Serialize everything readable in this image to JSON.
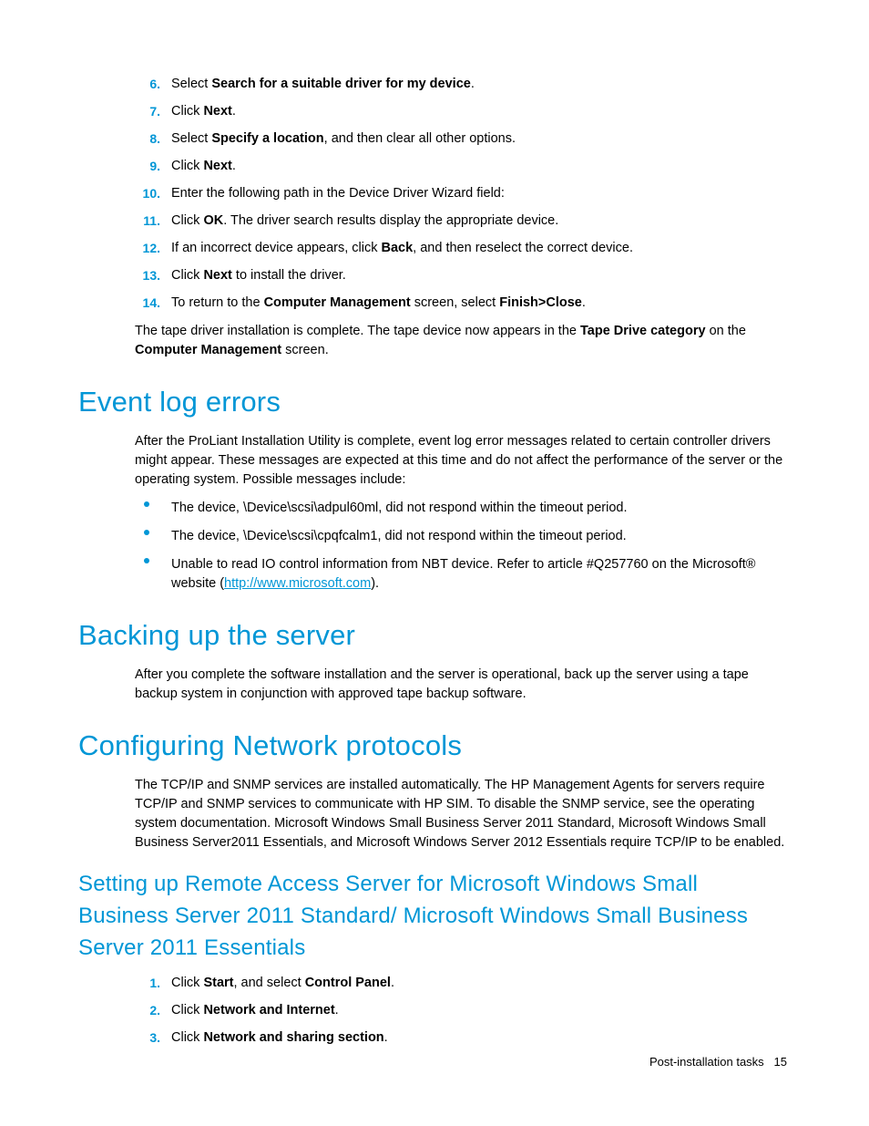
{
  "steps_top": [
    {
      "n": "6.",
      "pre": "Select ",
      "bold": "Search for a suitable driver for my device",
      "post": "."
    },
    {
      "n": "7.",
      "pre": "Click ",
      "bold": "Next",
      "post": "."
    },
    {
      "n": "8.",
      "pre": "Select ",
      "bold": "Specify a location",
      "post": ", and then clear all other options."
    },
    {
      "n": "9.",
      "pre": "Click ",
      "bold": "Next",
      "post": "."
    },
    {
      "n": "10.",
      "pre": "Enter the following path in the Device Driver Wizard field:",
      "bold": "",
      "post": ""
    },
    {
      "n": "11.",
      "pre": "Click ",
      "bold": "OK",
      "post": ". The driver search results display the appropriate device."
    },
    {
      "n": "12.",
      "pre": "If an incorrect device appears, click ",
      "bold": "Back",
      "post": ", and then reselect the correct device."
    },
    {
      "n": "13.",
      "pre": "Click ",
      "bold": "Next",
      "post": " to install the driver."
    },
    {
      "n": "14.",
      "pre": "To return to the ",
      "bold": "Computer Management",
      "post_mid": " screen, select ",
      "bold2": "Finish>Close",
      "post": "."
    }
  ],
  "tape_complete": {
    "t1": "The tape driver installation is complete. The tape device now appears in the ",
    "b1": "Tape Drive category",
    "t2": " on the ",
    "b2": "Computer Management",
    "t3": " screen."
  },
  "h_event": "Event log errors",
  "event_intro": "After the ProLiant Installation Utility is complete, event log error messages related to certain controller drivers might appear. These messages are expected at this time and do not affect the performance of the server or the operating system. Possible messages include:",
  "event_bullets": [
    {
      "text": "The device, \\Device\\scsi\\adpul60ml, did not respond within the timeout period."
    },
    {
      "text": "The device, \\Device\\scsi\\cpqfcalm1, did not respond within the timeout period."
    },
    {
      "text_pre": "Unable to read IO control information from NBT device. Refer to article #Q257760 on the Microsoft® website (",
      "link": "http://www.microsoft.com",
      "text_post": ")."
    }
  ],
  "h_backup": "Backing up the server",
  "backup_body": "After you complete the software installation and the server is operational, back up the server using a tape backup system in conjunction with approved tape backup software.",
  "h_config": "Configuring Network protocols",
  "config_body": "The TCP/IP and SNMP services are installed automatically. The HP  Management Agents  for servers require TCP/IP and SNMP services to communicate with HP  SIM. To disable the SNMP service, see the operating system documentation. Microsoft Windows Small Business Server  2011 Standard, Microsoft Windows Small Business Server2011 Essentials, and Microsoft Windows Server 2012 Essentials require TCP/IP to be enabled.",
  "h_remote": "Setting up Remote Access Server for Microsoft Windows Small Business Server 2011 Standard/ Microsoft Windows Small Business Server 2011 Essentials",
  "steps_remote": [
    {
      "n": "1.",
      "pre": "Click ",
      "bold": "Start",
      "post_mid": ", and select ",
      "bold2": "Control Panel",
      "post": "."
    },
    {
      "n": "2.",
      "pre": "Click ",
      "bold": "Network and Internet",
      "post": "."
    },
    {
      "n": "3.",
      "pre": "Click ",
      "bold": "Network and sharing section",
      "post": "."
    }
  ],
  "footer_section": "Post-installation tasks",
  "footer_page": "15"
}
